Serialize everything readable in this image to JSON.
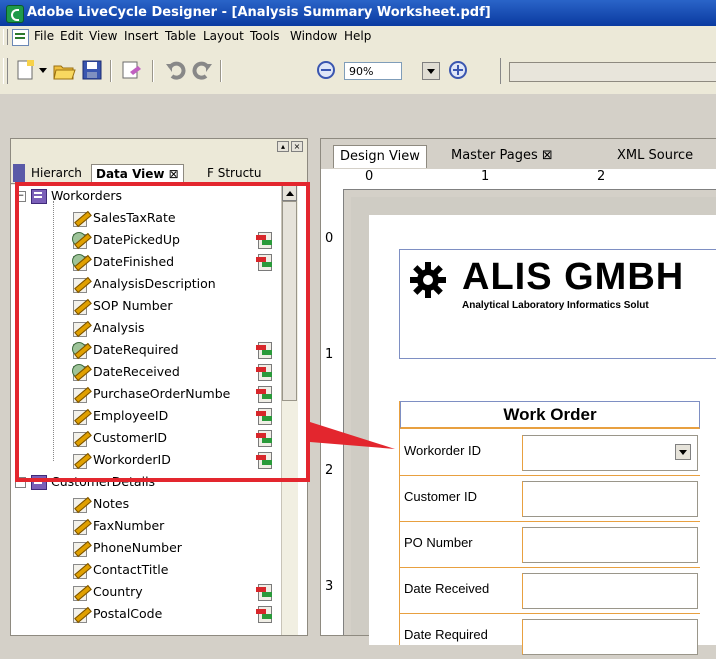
{
  "window": {
    "title": "Adobe LiveCycle Designer - [Analysis Summary Worksheet.pdf]"
  },
  "menu": [
    "File",
    "Edit",
    "View",
    "Insert",
    "Table",
    "Layout",
    "Tools",
    "Window",
    "Help"
  ],
  "toolbar": {
    "zoom": "90%"
  },
  "left_panel": {
    "tabs": [
      "Hierarch",
      "Data View",
      "F Structu"
    ],
    "groups": [
      {
        "name": "Workorders",
        "expanded": true,
        "fields": [
          {
            "label": "SalesTaxRate",
            "type": "text",
            "bound": false
          },
          {
            "label": "DatePickedUp",
            "type": "date",
            "bound": true
          },
          {
            "label": "DateFinished",
            "type": "date",
            "bound": true
          },
          {
            "label": "AnalysisDescription",
            "type": "text",
            "bound": false
          },
          {
            "label": "SOP Number",
            "type": "text",
            "bound": false
          },
          {
            "label": "Analysis",
            "type": "text",
            "bound": false
          },
          {
            "label": "DateRequired",
            "type": "date",
            "bound": true
          },
          {
            "label": "DateReceived",
            "type": "date",
            "bound": true
          },
          {
            "label": "PurchaseOrderNumbe",
            "type": "text",
            "bound": true
          },
          {
            "label": "EmployeeID",
            "type": "text",
            "bound": true
          },
          {
            "label": "CustomerID",
            "type": "text",
            "bound": true
          },
          {
            "label": "WorkorderID",
            "type": "text",
            "bound": true
          }
        ]
      },
      {
        "name": "CustomerDetails",
        "expanded": true,
        "fields": [
          {
            "label": "Notes",
            "type": "text",
            "bound": false
          },
          {
            "label": "FaxNumber",
            "type": "text",
            "bound": false
          },
          {
            "label": "PhoneNumber",
            "type": "text",
            "bound": false
          },
          {
            "label": "ContactTitle",
            "type": "text",
            "bound": false
          },
          {
            "label": "Country",
            "type": "text",
            "bound": true
          },
          {
            "label": "PostalCode",
            "type": "text",
            "bound": true
          }
        ]
      }
    ]
  },
  "design": {
    "tabs": [
      "Design View",
      "Master Pages",
      "XML Source"
    ],
    "ruler_h": [
      "0",
      "1",
      "2"
    ],
    "ruler_v": [
      "0",
      "1",
      "2",
      "3"
    ],
    "logo": {
      "name": "ALIS GMBH",
      "tagline": "Analytical Laboratory Informatics Solut"
    },
    "form_title": "Work Order",
    "form_fields": [
      "Workorder ID",
      "Customer ID",
      "PO Number",
      "Date Received",
      "Date Required"
    ]
  },
  "colors": {
    "highlight": "#e3262e",
    "field_border": "#e8a040",
    "titlebar": "#0a3aa0"
  }
}
